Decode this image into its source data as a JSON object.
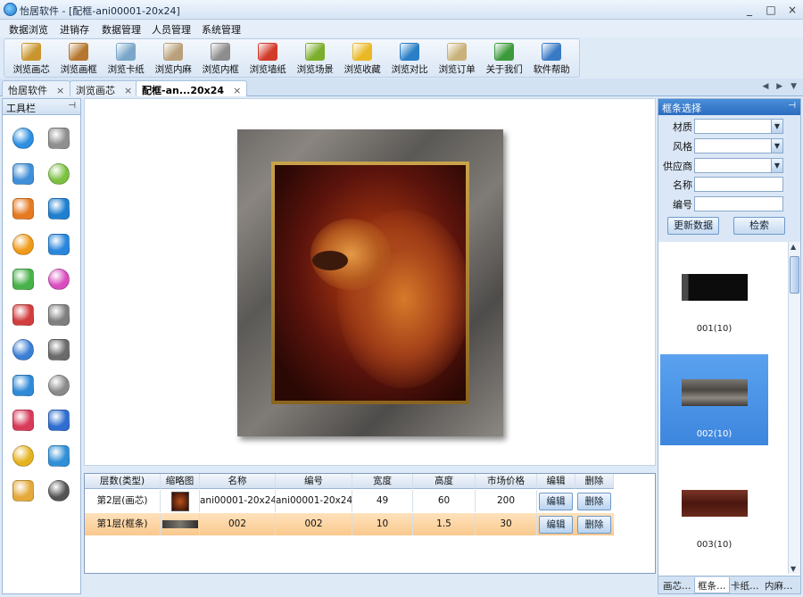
{
  "window": {
    "title": "怡居软件 - [配框-ani00001-20x24]",
    "minimize": "_",
    "restore": "□",
    "close": "×"
  },
  "menu": [
    "数据浏览",
    "进销存",
    "数据管理",
    "人员管理",
    "系统管理"
  ],
  "toolbar": [
    {
      "label": "浏览画芯",
      "icon": "painting-icon",
      "color": "#c8952e"
    },
    {
      "label": "浏览画框",
      "icon": "frame-icon",
      "color": "#b5772f"
    },
    {
      "label": "浏览卡纸",
      "icon": "magnifier-icon",
      "color": "#7aa7c9"
    },
    {
      "label": "浏览内麻",
      "icon": "magnifier-user-icon",
      "color": "#b9a07a"
    },
    {
      "label": "浏览内框",
      "icon": "chain-link-icon",
      "color": "#8d8d8d"
    },
    {
      "label": "浏览墙纸",
      "icon": "house-icon",
      "color": "#d23a2a"
    },
    {
      "label": "浏览场景",
      "icon": "scene-icon",
      "color": "#7cae2b"
    },
    {
      "label": "浏览收藏",
      "icon": "star-icon",
      "color": "#e9b824"
    },
    {
      "label": "浏览对比",
      "icon": "compare-icon",
      "color": "#2a7fc7"
    },
    {
      "label": "浏览订单",
      "icon": "order-icon",
      "color": "#c9b27a"
    },
    {
      "label": "关于我们",
      "icon": "people-icon",
      "color": "#3c9a3a"
    },
    {
      "label": "软件帮助",
      "icon": "help-book-icon",
      "color": "#3a7ac5"
    }
  ],
  "tabs": [
    {
      "label": "怡居软件",
      "close": "×"
    },
    {
      "label": "浏览画芯",
      "close": "×"
    },
    {
      "label": "配框-an...20x24",
      "close": "×"
    }
  ],
  "tab_nav": "◀ ▶ ▼",
  "left_panel": {
    "title": "工具栏",
    "pin": "📌"
  },
  "tools": [
    {
      "icon": "zoom-in-icon",
      "color": "#2d8fe0"
    },
    {
      "icon": "zoom-out-icon",
      "color": "#8f8f8f"
    },
    {
      "icon": "duplicate-window-icon",
      "color": "#3f8fd8"
    },
    {
      "icon": "rotate-icon",
      "color": "#7cc142"
    },
    {
      "icon": "windows-flag-icon",
      "color": "#e57a22"
    },
    {
      "icon": "monitor-add-icon",
      "color": "#1f7fd0"
    },
    {
      "icon": "sun-gear-icon",
      "color": "#f09a18"
    },
    {
      "icon": "globe-refresh-icon",
      "color": "#2a86dc"
    },
    {
      "icon": "puzzle-icon",
      "color": "#48b24a"
    },
    {
      "icon": "color-palette-icon",
      "color": "#d94dc0"
    },
    {
      "icon": "sofa-add-icon",
      "color": "#d23d3d"
    },
    {
      "icon": "sofa-icon",
      "color": "#7f7f7f"
    },
    {
      "icon": "tilt-image-icon",
      "color": "#3b7fd6"
    },
    {
      "icon": "stack-layers-icon",
      "color": "#6b6b6b"
    },
    {
      "icon": "home-add-icon",
      "color": "#2f8ad8"
    },
    {
      "icon": "home-icon",
      "color": "#8a8a8a"
    },
    {
      "icon": "books-add-icon",
      "color": "#d83a5a"
    },
    {
      "icon": "books-icon",
      "color": "#2f6ed0"
    },
    {
      "icon": "star-add-icon",
      "color": "#e6b21e"
    },
    {
      "icon": "basket-icon",
      "color": "#2f8fd8"
    },
    {
      "icon": "folder-open-icon",
      "color": "#e4a93a"
    },
    {
      "icon": "printer-icon",
      "color": "#555555"
    }
  ],
  "grid": {
    "headers": [
      "层数(类型)",
      "缩略图",
      "名称",
      "编号",
      "宽度",
      "高度",
      "市场价格",
      "编辑",
      "删除"
    ],
    "rows": [
      {
        "layer": "第2层(画芯)",
        "name": "ani00001-20x24",
        "code": "ani00001-20x24",
        "width": "49",
        "height": "60",
        "price": "200",
        "edit": "编辑",
        "delete": "删除"
      },
      {
        "layer": "第1层(框条)",
        "name": "002",
        "code": "002",
        "width": "10",
        "height": "1.5",
        "price": "30",
        "edit": "编辑",
        "delete": "删除"
      }
    ]
  },
  "right_panel": {
    "title": "框条选择",
    "pin": "📌",
    "fields": {
      "material": "材质",
      "style": "风格",
      "supplier": "供应商",
      "name": "名称",
      "code": "编号"
    },
    "update_button": "更新数据",
    "search_button": "检索",
    "mouldings": [
      {
        "caption": "001(10)",
        "color": "#1c1c1c",
        "selected": false
      },
      {
        "caption": "002(10)",
        "color": "#5f5a54",
        "selected": true
      },
      {
        "caption": "003(10)",
        "color": "#5a231a",
        "selected": false
      }
    ],
    "scroll_up": "▲",
    "scroll_down": "▼",
    "tabs": [
      "画芯…",
      "框条…",
      "卡纸…",
      "内麻…"
    ]
  }
}
